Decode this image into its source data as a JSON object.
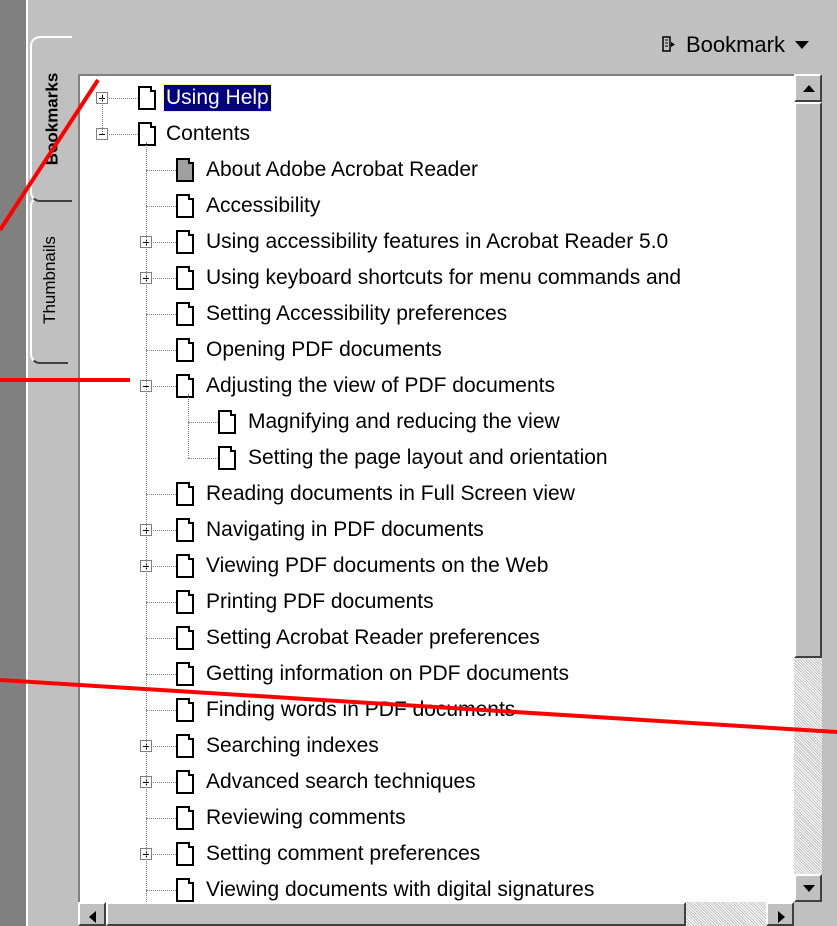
{
  "header": {
    "bookmark_menu_label": "Bookmark",
    "bookmark_menu_icon": "bookmark-options-icon"
  },
  "tabs": [
    {
      "label": "Bookmarks",
      "active": true
    },
    {
      "label": "Thumbnails",
      "active": false
    }
  ],
  "tree": [
    {
      "label": "Using Help",
      "level": 0,
      "expander": "plus",
      "selected": true
    },
    {
      "label": "Contents",
      "level": 0,
      "expander": "minus"
    },
    {
      "label": "About Adobe Acrobat Reader",
      "level": 1,
      "expander": null,
      "icon_grey": true
    },
    {
      "label": "Accessibility",
      "level": 1,
      "expander": null
    },
    {
      "label": "Using accessibility features in Acrobat Reader 5.0",
      "level": 1,
      "expander": "plus"
    },
    {
      "label": "Using keyboard shortcuts for menu commands and",
      "level": 1,
      "expander": "plus"
    },
    {
      "label": "Setting Accessibility preferences",
      "level": 1,
      "expander": null
    },
    {
      "label": "Opening PDF documents",
      "level": 1,
      "expander": null
    },
    {
      "label": "Adjusting the view of PDF documents",
      "level": 1,
      "expander": "minus"
    },
    {
      "label": "Magnifying and reducing the view",
      "level": 2,
      "expander": null
    },
    {
      "label": "Setting the page layout and orientation",
      "level": 2,
      "expander": null
    },
    {
      "label": "Reading documents in Full Screen view",
      "level": 1,
      "expander": null
    },
    {
      "label": "Navigating in PDF documents",
      "level": 1,
      "expander": "plus"
    },
    {
      "label": "Viewing PDF documents on the Web",
      "level": 1,
      "expander": "plus"
    },
    {
      "label": "Printing PDF documents",
      "level": 1,
      "expander": null
    },
    {
      "label": "Setting Acrobat Reader preferences",
      "level": 1,
      "expander": null
    },
    {
      "label": "Getting information on PDF documents",
      "level": 1,
      "expander": null
    },
    {
      "label": "Finding words in PDF documents",
      "level": 1,
      "expander": null
    },
    {
      "label": "Searching indexes",
      "level": 1,
      "expander": "plus"
    },
    {
      "label": "Advanced search techniques",
      "level": 1,
      "expander": "plus"
    },
    {
      "label": "Reviewing comments",
      "level": 1,
      "expander": null
    },
    {
      "label": "Setting comment preferences",
      "level": 1,
      "expander": "plus"
    },
    {
      "label": "Viewing documents with digital signatures",
      "level": 1,
      "expander": null
    }
  ],
  "scroll": {
    "vertical_position": 0.0,
    "vertical_visible_fraction": 0.72,
    "horizontal_position": 0.0
  },
  "colors": {
    "selection": "#000080",
    "annotation": "#ff0000",
    "panel": "#c0c0c0"
  }
}
